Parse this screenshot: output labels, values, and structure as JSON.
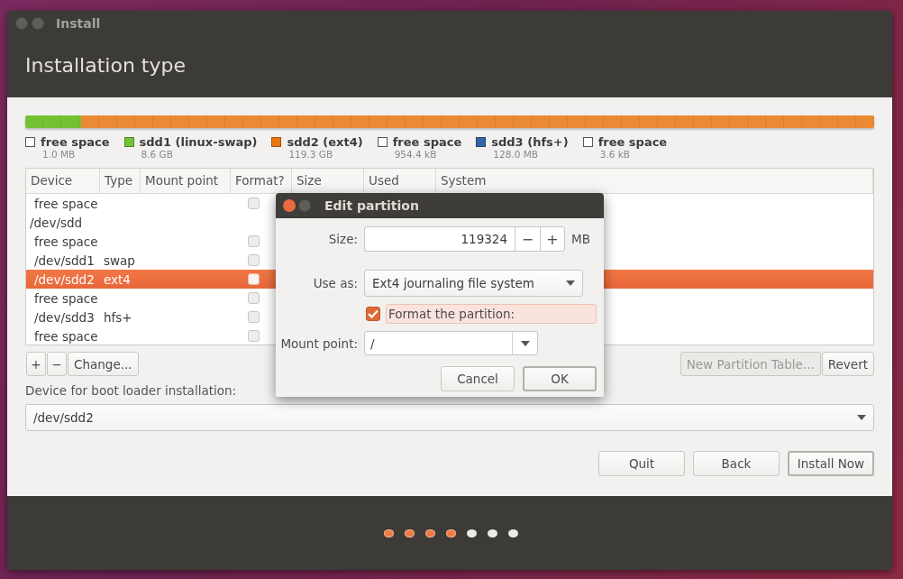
{
  "window": {
    "title": "Install",
    "heading": "Installation type"
  },
  "partition_bar": {
    "segments": [
      {
        "color": "#73c233",
        "level": 0.066
      },
      {
        "color": "#ea8a35",
        "level": 0.934
      }
    ]
  },
  "legend": [
    {
      "kind": "free",
      "label": "free space",
      "size": "1.0 MB"
    },
    {
      "kind": "partition",
      "label": "sdd1 (linux-swap)",
      "size": "8.6 GB",
      "color": "#73c233"
    },
    {
      "kind": "partition",
      "label": "sdd2 (ext4)",
      "size": "119.3 GB",
      "color": "#e8760f"
    },
    {
      "kind": "free",
      "label": "free space",
      "size": "954.4 kB"
    },
    {
      "kind": "partition",
      "label": "sdd3 (hfs+)",
      "size": "128.0 MB",
      "color": "#3465a4"
    },
    {
      "kind": "free",
      "label": "free space",
      "size": "3.6 kB"
    }
  ],
  "table": {
    "columns": [
      "Device",
      "Type",
      "Mount point",
      "Format?",
      "Size",
      "Used",
      "System"
    ],
    "rows": [
      {
        "kind": "free",
        "device": "free space",
        "format": false,
        "selected": false
      },
      {
        "kind": "disk",
        "device": "/dev/sdd",
        "selected": false
      },
      {
        "kind": "free",
        "device": "free space",
        "format": false,
        "selected": false
      },
      {
        "kind": "partition",
        "device": "/dev/sdd1",
        "type": "swap",
        "format": false,
        "selected": false
      },
      {
        "kind": "partition",
        "device": "/dev/sdd2",
        "type": "ext4",
        "format": false,
        "selected": true
      },
      {
        "kind": "free",
        "device": "free space",
        "format": false,
        "selected": false
      },
      {
        "kind": "partition",
        "device": "/dev/sdd3",
        "type": "hfs+",
        "format": false,
        "selected": false
      },
      {
        "kind": "free",
        "device": "free space",
        "format": false,
        "selected": false
      }
    ]
  },
  "table_buttons": {
    "left": [
      "+",
      "−",
      "Change..."
    ],
    "right": [
      {
        "label": "New Partition Table...",
        "disabled": true
      },
      {
        "label": "Revert",
        "disabled": false
      }
    ]
  },
  "boot_loader": {
    "label": "Device for boot loader installation:",
    "value": "/dev/sdd2"
  },
  "nav_buttons": [
    {
      "label": "Quit",
      "default": false
    },
    {
      "label": "Back",
      "default": false
    },
    {
      "label": "Install Now",
      "default": true
    }
  ],
  "steps": [
    {
      "done": true
    },
    {
      "done": true
    },
    {
      "done": true
    },
    {
      "done": true
    },
    {
      "done": false
    },
    {
      "done": false
    },
    {
      "done": false
    }
  ],
  "dialog": {
    "title": "Edit partition",
    "size_label": "Size:",
    "size_value": "119324",
    "minus": "−",
    "plus": "+",
    "unit": "MB",
    "use_as_label": "Use as:",
    "use_as_value": "Ext4 journaling file system",
    "format": {
      "label": "Format the partition:",
      "checked": true
    },
    "mount_label": "Mount point:",
    "mount_value": "/",
    "buttons": [
      {
        "label": "Cancel",
        "default": false
      },
      {
        "label": "OK",
        "default": true
      }
    ]
  }
}
